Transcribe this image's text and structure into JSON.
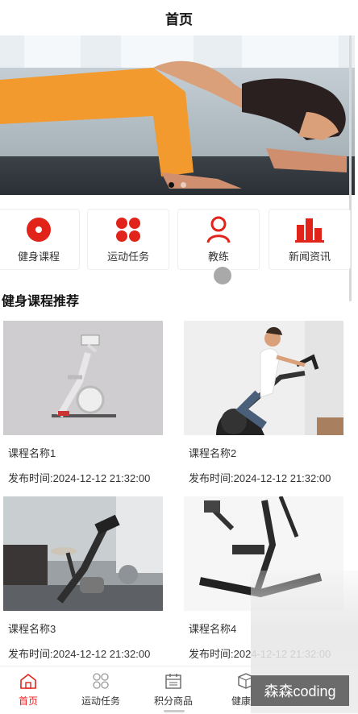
{
  "header": {
    "title": "首页"
  },
  "banner": {
    "slides": 2,
    "active_index": 0
  },
  "quick_nav": [
    {
      "label": "健身课程",
      "icon": "target-circle-icon"
    },
    {
      "label": "运动任务",
      "icon": "four-dots-icon"
    },
    {
      "label": "教练",
      "icon": "person-icon"
    },
    {
      "label": "新闻资讯",
      "icon": "buildings-chart-icon"
    }
  ],
  "section": {
    "title": "健身课程推荐"
  },
  "courses": [
    {
      "name": "课程名称1",
      "time": "发布时间:2024-12-12 21:32:00"
    },
    {
      "name": "课程名称2",
      "time": "发布时间:2024-12-12 21:32:00"
    },
    {
      "name": "课程名称3",
      "time": "发布时间:2024-12-12 21:32:00"
    },
    {
      "name": "课程名称4",
      "time": "发布时间:2024-12-12 21:32:00"
    }
  ],
  "tabbar": [
    {
      "label": "首页",
      "icon": "home-icon",
      "active": true
    },
    {
      "label": "运动任务",
      "icon": "four-circles-icon",
      "active": false
    },
    {
      "label": "积分商品",
      "icon": "calendar-icon",
      "active": false
    },
    {
      "label": "健康智",
      "icon": "box-icon",
      "active": false
    }
  ],
  "watermark": {
    "text": "森森coding"
  },
  "colors": {
    "accent": "#e2231a",
    "text": "#333333"
  }
}
